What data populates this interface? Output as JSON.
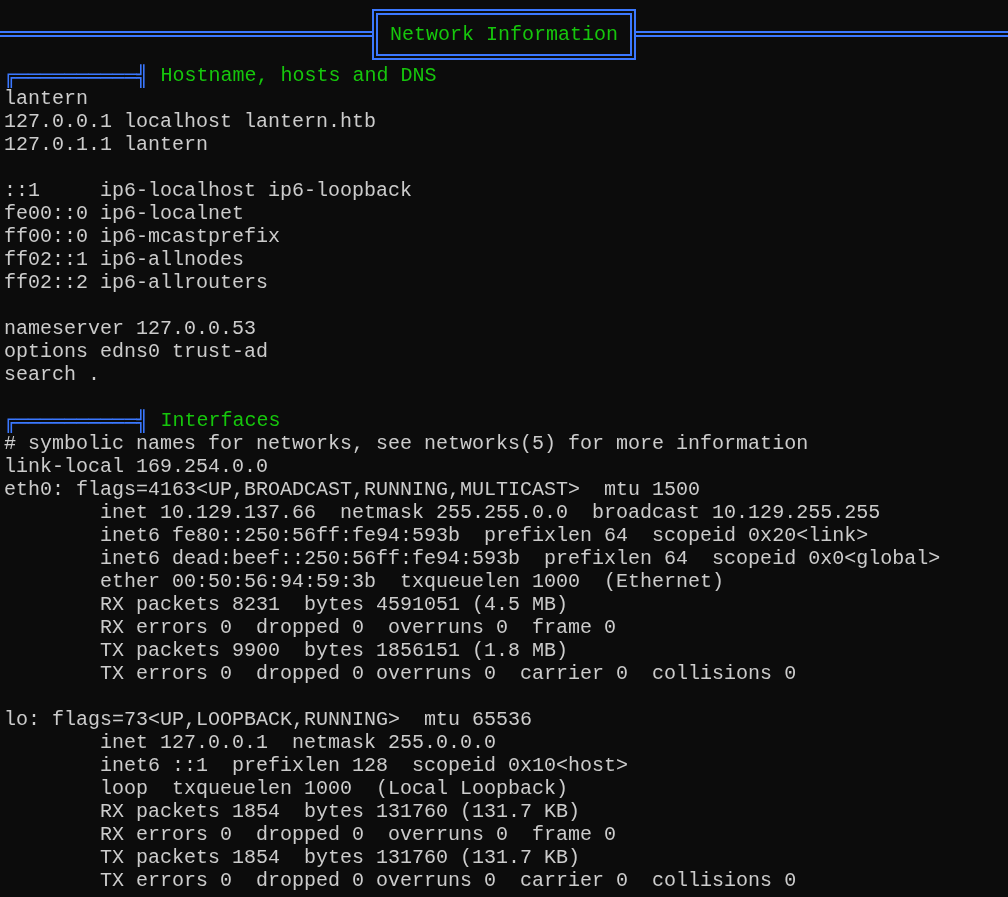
{
  "banner": {
    "title": "Network Information"
  },
  "sections": [
    {
      "marker": "╔══════════╣",
      "title": "Hostname, hosts and DNS",
      "blocks": [
        [
          "lantern",
          "127.0.0.1 localhost lantern.htb",
          "127.0.1.1 lantern"
        ],
        [
          "::1     ip6-localhost ip6-loopback",
          "fe00::0 ip6-localnet",
          "ff00::0 ip6-mcastprefix",
          "ff02::1 ip6-allnodes",
          "ff02::2 ip6-allrouters"
        ],
        [
          "nameserver 127.0.0.53",
          "options edns0 trust-ad",
          "search ."
        ]
      ]
    },
    {
      "marker": "╔══════════╣",
      "title": "Interfaces",
      "blocks": [
        [
          "# symbolic names for networks, see networks(5) for more information",
          "link-local 169.254.0.0",
          "eth0: flags=4163<UP,BROADCAST,RUNNING,MULTICAST>  mtu 1500",
          "        inet 10.129.137.66  netmask 255.255.0.0  broadcast 10.129.255.255",
          "        inet6 fe80::250:56ff:fe94:593b  prefixlen 64  scopeid 0x20<link>",
          "        inet6 dead:beef::250:56ff:fe94:593b  prefixlen 64  scopeid 0x0<global>",
          "        ether 00:50:56:94:59:3b  txqueuelen 1000  (Ethernet)",
          "        RX packets 8231  bytes 4591051 (4.5 MB)",
          "        RX errors 0  dropped 0  overruns 0  frame 0",
          "        TX packets 9900  bytes 1856151 (1.8 MB)",
          "        TX errors 0  dropped 0 overruns 0  carrier 0  collisions 0"
        ],
        [
          "lo: flags=73<UP,LOOPBACK,RUNNING>  mtu 65536",
          "        inet 127.0.0.1  netmask 255.0.0.0",
          "        inet6 ::1  prefixlen 128  scopeid 0x10<host>",
          "        loop  txqueuelen 1000  (Local Loopback)",
          "        RX packets 1854  bytes 131760 (131.7 KB)",
          "        RX errors 0  dropped 0  overruns 0  frame 0",
          "        TX packets 1854  bytes 131760 (131.7 KB)",
          "        TX errors 0  dropped 0 overruns 0  carrier 0  collisions 0"
        ]
      ]
    }
  ]
}
